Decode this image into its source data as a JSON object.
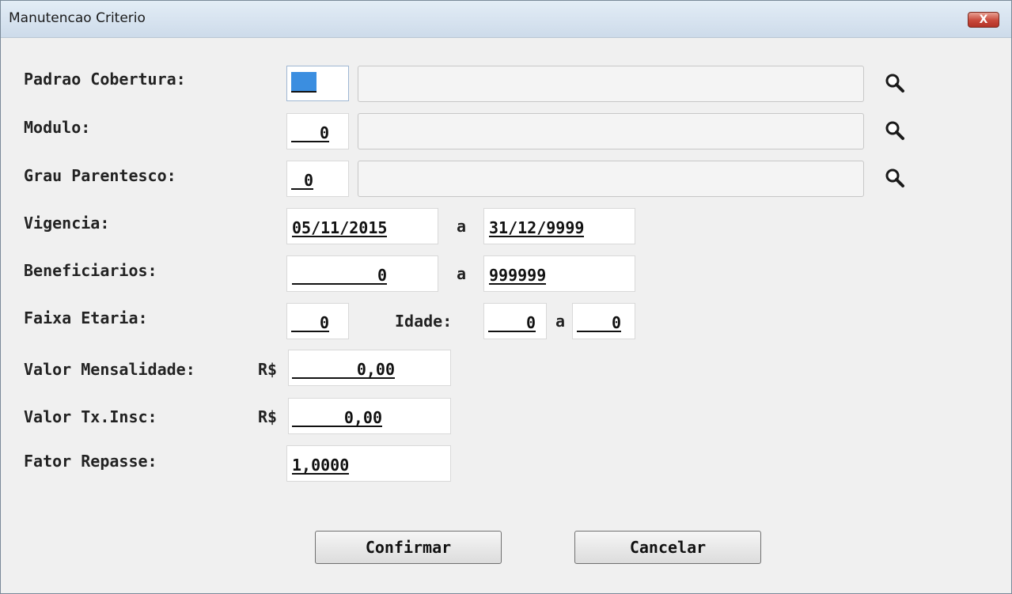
{
  "window": {
    "title": "Manutencao Criterio",
    "close_label": "X"
  },
  "fields": {
    "padrao_cobertura": {
      "label": "Padrao Cobertura:",
      "value": ""
    },
    "modulo": {
      "label": "Modulo:",
      "value": "0"
    },
    "grau_parentesco": {
      "label": "Grau Parentesco:",
      "value": "0"
    },
    "vigencia": {
      "label": "Vigencia:",
      "from": "05/11/2015",
      "sep": "a",
      "to": "31/12/9999"
    },
    "beneficiarios": {
      "label": "Beneficiarios:",
      "from": "0",
      "sep": "a",
      "to": "999999"
    },
    "faixa_etaria": {
      "label": "Faixa Etaria:",
      "value": "0",
      "idade_label": "Idade:",
      "idade_from": "0",
      "sep": "a",
      "idade_to": "0"
    },
    "valor_mensalidade": {
      "label": "Valor Mensalidade:",
      "currency": "R$",
      "value": "0,00"
    },
    "valor_tx_insc": {
      "label": "Valor Tx.Insc:",
      "currency": "R$",
      "value": "0,00"
    },
    "fator_repasse": {
      "label": "Fator Repasse:",
      "value": "1,0000"
    }
  },
  "buttons": {
    "confirm": "Confirmar",
    "cancel": "Cancelar"
  },
  "icons": {
    "lookup": "magnifier-icon",
    "close": "close-icon"
  },
  "colors": {
    "accent_cursor": "#3b8ee0",
    "close_button": "#c8483a"
  }
}
